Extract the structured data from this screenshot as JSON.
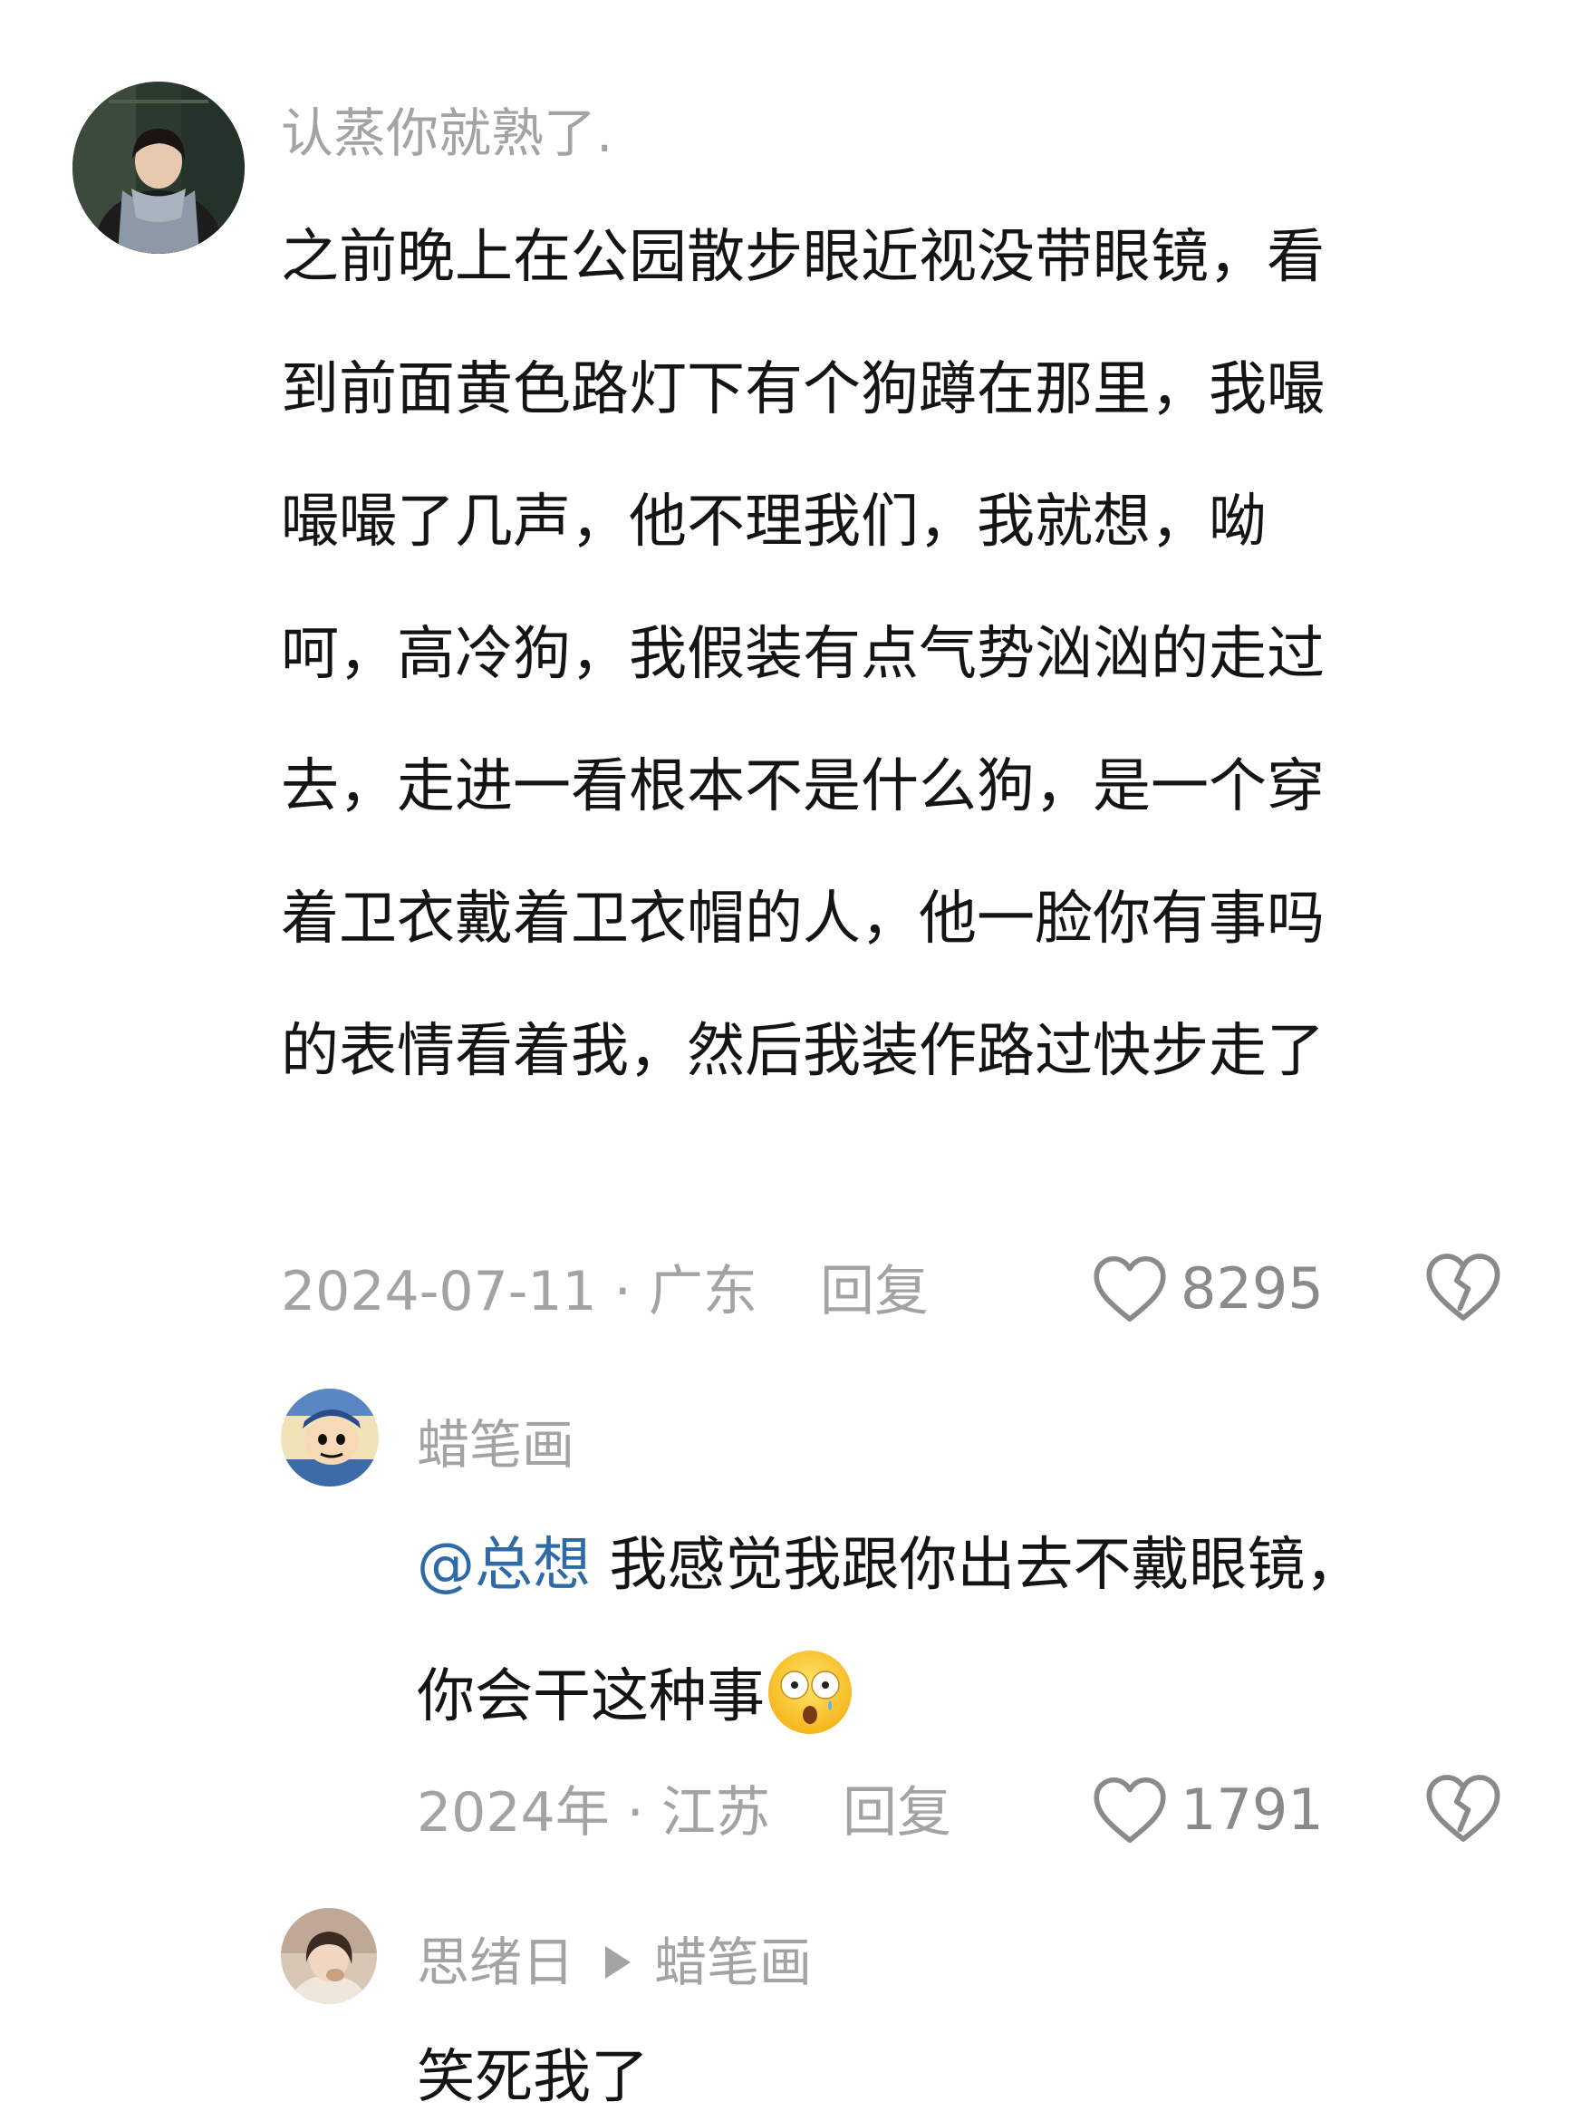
{
  "comments": [
    {
      "username": "认蒸你就熟了.",
      "lines": [
        "之前晚上在公园散步眼近视没带眼镜，看",
        "到前面黄色路灯下有个狗蹲在那里，我嘬",
        "嘬嘬了几声，他不理我们，我就想，呦",
        "呵，高冷狗，我假装有点气势汹汹的走过",
        "去，走进一看根本不是什么狗，是一个穿",
        "着卫衣戴着卫衣帽的人，他一脸你有事吗",
        "的表情看着我，然后我装作路过快步走了"
      ],
      "date": "2024-07-11",
      "location": "广东",
      "separator": " · ",
      "reply_label": "回复",
      "likes": "8295"
    },
    {
      "username": "蜡笔画",
      "mention": "@总想",
      "line1_rest": "我感觉我跟你出去不戴眼镜，",
      "line2": "你会干这种事",
      "emoji_name": "shocked-face-emoji",
      "date": "2024年",
      "location": "江苏",
      "separator": " · ",
      "reply_label": "回复",
      "likes": "1791"
    },
    {
      "username": "思绪日",
      "reply_to": "蜡笔画",
      "text": "笑死我了"
    }
  ],
  "colors": {
    "text": "#141414",
    "muted": "#a3a3a3",
    "mention": "#2f6aa8",
    "background": "#ffffff"
  },
  "icons": {
    "like": "heart-outline-icon",
    "dislike": "broken-heart-icon",
    "reply_arrow": "triangle-right-icon"
  }
}
